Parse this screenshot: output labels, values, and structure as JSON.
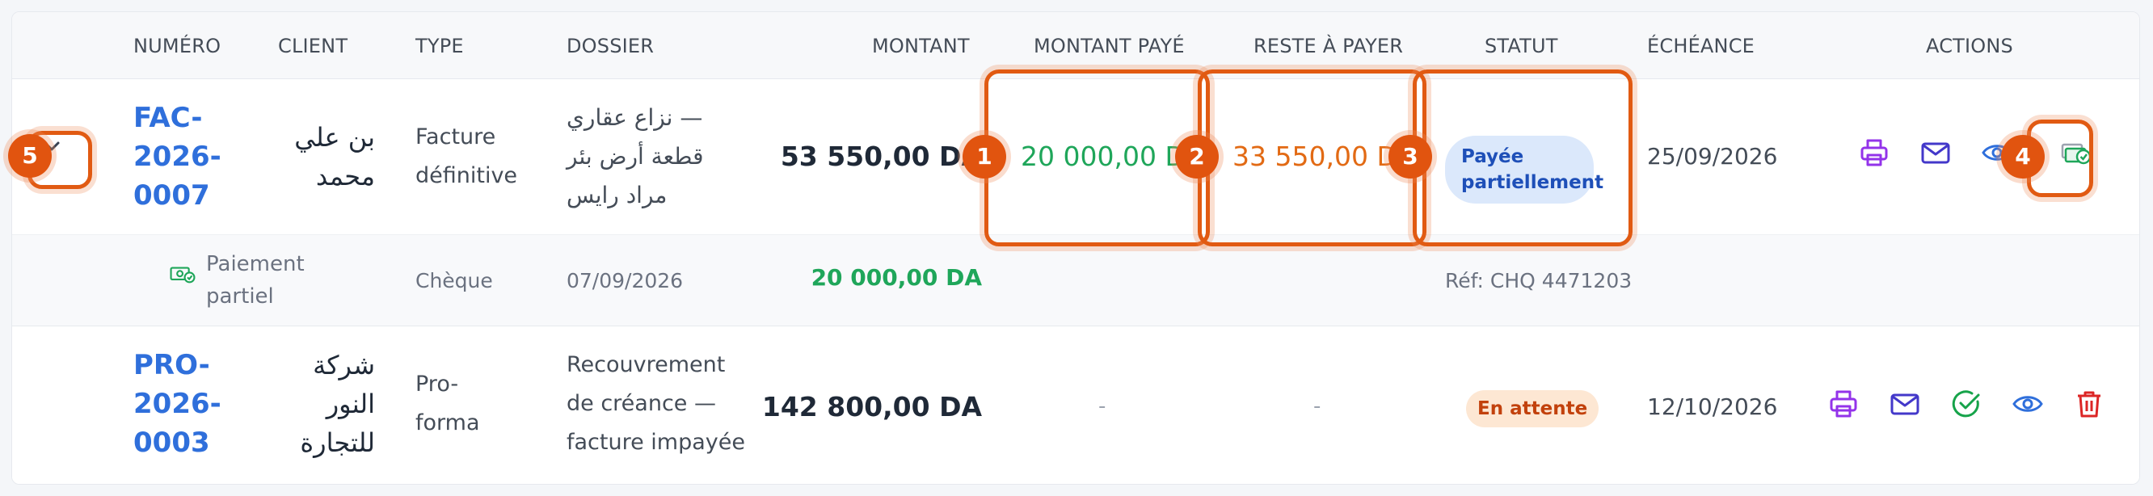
{
  "headers": {
    "numero": "NUMÉRO",
    "client": "CLIENT",
    "type": "TYPE",
    "dossier": "DOSSIER",
    "montant": "MONTANT",
    "montant_paye": "MONTANT PAYÉ",
    "reste": "RESTE À PAYER",
    "statut": "STATUT",
    "echeance": "ÉCHÉANCE",
    "actions": "ACTIONS"
  },
  "rows": [
    {
      "numero_lines": [
        "FAC-",
        "2026-",
        "0007"
      ],
      "client_lines": [
        "بن علي",
        "محمد"
      ],
      "type_lines": [
        "Facture",
        "définitive"
      ],
      "dossier_lines": [
        "نزاع عقاري —",
        "قطعة أرض بئر",
        "مراد رايس"
      ],
      "montant": "53 550,00 DA",
      "montant_paye": "20 000,00 DA",
      "reste": "33 550,00 DA",
      "statut_lines": [
        "Payée",
        "partiellement"
      ],
      "echeance": "25/09/2026",
      "payment": {
        "label_lines": [
          "Paiement",
          "partiel"
        ],
        "mode": "Chèque",
        "date": "07/09/2026",
        "amount": "20 000,00 DA",
        "ref": "Réf: CHQ 4471203"
      }
    },
    {
      "numero_lines": [
        "PRO-",
        "2026-",
        "0003"
      ],
      "client_lines": [
        "شركة",
        "النور",
        "للتجارة"
      ],
      "type_lines": [
        "Pro-",
        "forma"
      ],
      "dossier_lines": [
        "Recouvrement",
        "de créance —",
        "facture impayée"
      ],
      "montant": "142 800,00 DA",
      "montant_paye": "-",
      "reste": "-",
      "statut": "En attente",
      "echeance": "12/10/2026"
    }
  ],
  "markers": [
    "1",
    "2",
    "3",
    "4",
    "5"
  ],
  "icons": [
    "chevron-down-icon",
    "printer-icon",
    "mail-icon",
    "eye-icon",
    "payment-icon",
    "check-circle-icon",
    "trash-icon",
    "money-icon"
  ],
  "colors": {
    "link": "#2f6fdb",
    "paid": "#1fa65a",
    "remaining": "#e26a14",
    "highlight": "#e15a12",
    "badge_partial_bg": "#dbe8fb",
    "badge_wait_bg": "#fde7d3"
  }
}
